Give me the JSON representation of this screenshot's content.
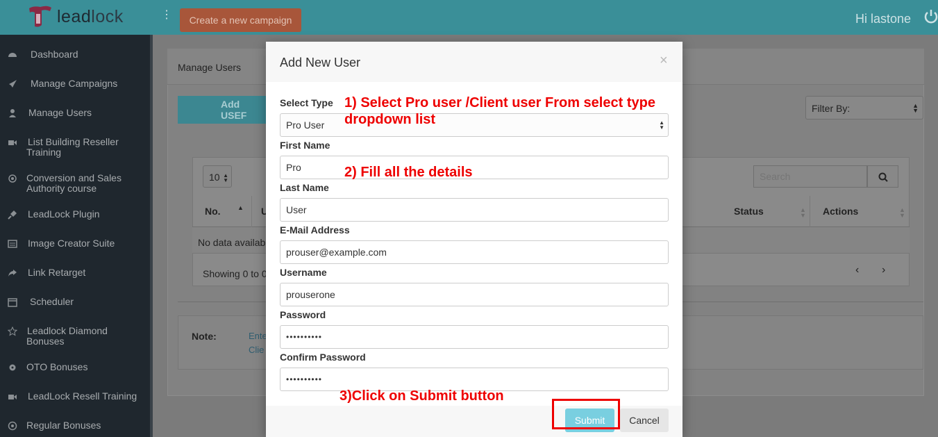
{
  "app": {
    "logo_text_bold": "lead",
    "logo_text_light": "lock",
    "menu_icon": "vertical-ellipsis-icon",
    "create_campaign_label": "Create a new campaign",
    "greeting": "Hi lastone",
    "power_icon": "power-icon"
  },
  "sidebar": {
    "items": [
      {
        "icon": "dashboard-icon",
        "line1": "Dashboard",
        "line2": ""
      },
      {
        "icon": "rocket-icon",
        "line1": "Manage Campaigns",
        "line2": ""
      },
      {
        "icon": "user-icon",
        "line1": "Manage Users",
        "line2": ""
      },
      {
        "icon": "video-icon",
        "line1": "List Building Reseller",
        "line2": "Training"
      },
      {
        "icon": "target-icon",
        "line1": "Conversion and Sales",
        "line2": "Authority course"
      },
      {
        "icon": "plug-icon",
        "line1": "LeadLock Plugin",
        "line2": ""
      },
      {
        "icon": "image-icon",
        "line1": "Image Creator Suite",
        "line2": ""
      },
      {
        "icon": "share-icon",
        "line1": "Link Retarget",
        "line2": ""
      },
      {
        "icon": "calendar-icon",
        "line1": "Scheduler",
        "line2": ""
      },
      {
        "icon": "star-icon",
        "line1": "Leadlock Diamond",
        "line2": "Bonuses"
      },
      {
        "icon": "gear-icon",
        "line1": "OTO Bonuses",
        "line2": ""
      },
      {
        "icon": "video-icon",
        "line1": "LeadLock Resell Training",
        "line2": ""
      },
      {
        "icon": "globe-icon",
        "line1": "Regular Bonuses",
        "line2": ""
      }
    ]
  },
  "page": {
    "title": "Manage Users",
    "add_user_label": "Add USEF",
    "filter_label": "Filter By:",
    "page_length": "10",
    "search_placeholder": "Search",
    "columns": {
      "no": "No.",
      "u": "U",
      "status": "Status",
      "actions": "Actions"
    },
    "no_data": "No data availab",
    "showing": "Showing 0 to 0",
    "prev": "‹",
    "next": "›",
    "note_label": "Note:",
    "note_line1": "Ente",
    "note_line2": "Clie"
  },
  "modal": {
    "title": "Add New User",
    "close": "×",
    "fields": {
      "select_type_label": "Select Type",
      "select_type_value": "Pro User",
      "first_name_label": "First Name",
      "first_name_value": "Pro",
      "last_name_label": "Last Name",
      "last_name_value": "User",
      "email_label": "E-Mail Address",
      "email_value": "prouser@example.com",
      "username_label": "Username",
      "username_value": "prouserone",
      "password_label": "Password",
      "password_value": "••••••••••",
      "confirm_password_label": "Confirm Password",
      "confirm_password_value": "••••••••••"
    },
    "submit_label": "Submit",
    "cancel_label": "Cancel"
  },
  "annotations": {
    "step1_line1": "1) Select Pro user /Client user From select type",
    "step1_line2": "dropdown list",
    "step2": "2) Fill all the details",
    "step3": "3)Click on Submit button",
    "color": "#ee0000"
  },
  "colors": {
    "topbar": "#3a8f98",
    "sidebar": "#1f272e",
    "submit": "#79cfe0",
    "create_campaign": "#a8563a"
  }
}
